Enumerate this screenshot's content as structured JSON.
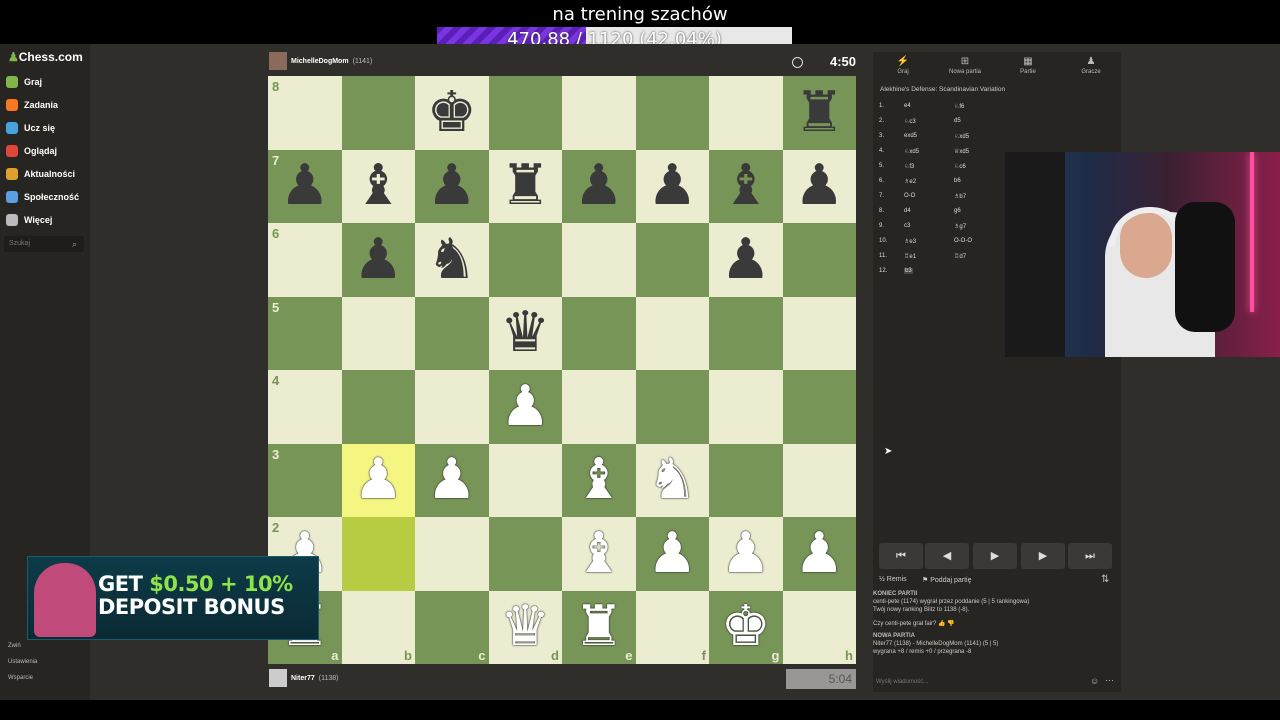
{
  "overlay": {
    "title": "na trening szachów",
    "goal_current": "470.88",
    "goal_separator": "/",
    "goal_target": "1120",
    "goal_percent_text": "(42.04%)",
    "goal_fraction": 0.4204
  },
  "sidebar": {
    "logo": "Chess.com",
    "items": [
      {
        "label": "Graj",
        "icon": "play-icon",
        "color": "#81b64c"
      },
      {
        "label": "Zadania",
        "icon": "puzzle-icon",
        "color": "#f7781f"
      },
      {
        "label": "Ucz się",
        "icon": "learn-icon",
        "color": "#4aa3df"
      },
      {
        "label": "Oglądaj",
        "icon": "watch-icon",
        "color": "#e0463a"
      },
      {
        "label": "Aktualności",
        "icon": "news-icon",
        "color": "#e0a030"
      },
      {
        "label": "Społeczność",
        "icon": "community-icon",
        "color": "#5aa0e0"
      },
      {
        "label": "Więcej",
        "icon": "more-icon",
        "color": "#bbb"
      }
    ],
    "search_placeholder": "Szukaj",
    "bottom": [
      {
        "label": "Zwiń"
      },
      {
        "label": "Ustawienia"
      },
      {
        "label": "Wsparcie"
      }
    ]
  },
  "top_player": {
    "name": "MichelleDogMom",
    "rating": "(1141)",
    "clock": "4:50"
  },
  "bottom_player": {
    "name": "Niter77",
    "rating": "(1138)",
    "clock": "5:04"
  },
  "board": {
    "ranks": [
      "8",
      "7",
      "6",
      "5",
      "4",
      "3",
      "2",
      "1"
    ],
    "files": [
      "a",
      "b",
      "c",
      "d",
      "e",
      "f",
      "g",
      "h"
    ],
    "squares": [
      [
        "",
        "",
        "bk",
        "",
        "",
        "",
        "",
        "br"
      ],
      [
        "bp",
        "bb",
        "bp",
        "br",
        "bp",
        "bp",
        "bb",
        "bp"
      ],
      [
        "",
        "bp",
        "bn",
        "",
        "",
        "",
        "bp",
        ""
      ],
      [
        "",
        "",
        "",
        "bq",
        "",
        "",
        "",
        ""
      ],
      [
        "",
        "",
        "",
        "wp",
        "",
        "",
        "",
        ""
      ],
      [
        "",
        "wp",
        "wp",
        "",
        "wb",
        "wn",
        "",
        ""
      ],
      [
        "wp",
        "",
        "",
        "",
        "wb",
        "wp",
        "wp",
        "wp"
      ],
      [
        "wr",
        "",
        "",
        "wq",
        "wr",
        "",
        "wk",
        ""
      ]
    ],
    "highlights": [
      [
        5,
        1
      ],
      [
        6,
        1
      ]
    ]
  },
  "panel": {
    "tabs": [
      {
        "label": "Graj",
        "icon": "bolt-icon"
      },
      {
        "label": "Nowa partia",
        "icon": "plus-icon"
      },
      {
        "label": "Partie",
        "icon": "board-icon"
      },
      {
        "label": "Gracze",
        "icon": "players-icon"
      }
    ],
    "opening": "Alekhine's Defense: Scandinavian Variation",
    "moves": [
      {
        "n": "1.",
        "w": "e4",
        "b": "♘f6"
      },
      {
        "n": "2.",
        "w": "♘c3",
        "b": "d5"
      },
      {
        "n": "3.",
        "w": "exd5",
        "b": "♘xd5"
      },
      {
        "n": "4.",
        "w": "♘xd5",
        "b": "♕xd5"
      },
      {
        "n": "5.",
        "w": "♘f3",
        "b": "♘c6"
      },
      {
        "n": "6.",
        "w": "♗e2",
        "b": "b6"
      },
      {
        "n": "7.",
        "w": "O-O",
        "b": "♗b7"
      },
      {
        "n": "8.",
        "w": "d4",
        "b": "g6"
      },
      {
        "n": "9.",
        "w": "c3",
        "b": "♗g7"
      },
      {
        "n": "10.",
        "w": "♗e3",
        "b": "O-O-O"
      },
      {
        "n": "11.",
        "w": "♖e1",
        "b": "♖d7"
      },
      {
        "n": "12.",
        "w": "b3",
        "b": ""
      }
    ],
    "controls": [
      "⏮",
      "◀",
      "▶",
      "▶",
      "⏭"
    ],
    "draw_label": "Remis",
    "resign_label": "Poddaj partię",
    "chat": {
      "end_heading": "KONIEC PARTII",
      "end_line1": "centi-pete (1174) wygrał przez poddanie (5 | 5 rankingowa)",
      "end_line2": "Twój nowy ranking Blitz to 1138 (-8).",
      "fair_question": "Czy centi-pete grał fair?",
      "new_heading": "NOWA PARTIA",
      "new_line1": "Niter77 (1138) - MichelleDogMom (1141) (5 | 5)",
      "new_line2": "wygrana +8 / remis +0 / przegrana -8"
    },
    "chat_placeholder": "Wyślij wiadomość..."
  },
  "ad": {
    "line1_a": "GET ",
    "line1_b": "$0.50 + 10%",
    "line2": "DEPOSIT BONUS"
  }
}
